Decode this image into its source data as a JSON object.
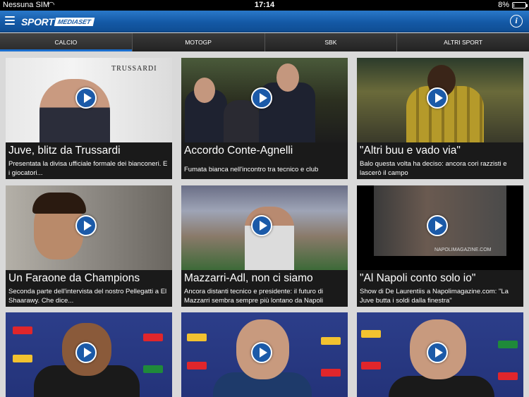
{
  "status_bar": {
    "carrier": "Nessuna SIM",
    "time": "17:14",
    "battery": "8%",
    "battery_level": 0.08
  },
  "navbar": {
    "logo_sport": "SPORT",
    "logo_mediaset": "MEDIASET",
    "info_glyph": "i"
  },
  "tabs": [
    {
      "label": "CALCIO",
      "active": true
    },
    {
      "label": "MOTOGP",
      "active": false
    },
    {
      "label": "SBK",
      "active": false
    },
    {
      "label": "ALTRI SPORT",
      "active": false
    }
  ],
  "accent_color": "#1b6fcf",
  "videos": [
    {
      "title": "Juve, blitz da Trussardi",
      "desc": "Presentata la divisa ufficiale formale dei bianconeri. E i giocatori...",
      "thumb_text": "TRUSSARDI"
    },
    {
      "title": "Accordo Conte-Agnelli",
      "desc": "Fumata bianca nell'incontro tra tecnico e club"
    },
    {
      "title": "\"Altri buu e vado via\"",
      "desc": "Balo questa volta ha deciso: ancora cori razzisti e lascerò il campo"
    },
    {
      "title": "Un Faraone da Champions",
      "desc": "Seconda parte dell'intervista del nostro Pellegatti a El Shaarawy. Che dice..."
    },
    {
      "title": "Mazzarri-Adl, non ci siamo",
      "desc": "Ancora distanti tecnico e presidente: il futuro di Mazzarri sembra sempre più lontano da Napoli"
    },
    {
      "title": "\"Al Napoli conto solo io\"",
      "desc": "Show di De Laurentiis a Napolimagazine.com: \"La Juve butta i soldi dalla finestra\"",
      "thumb_text": "NAPOLIMAGAZINE.COM"
    },
    {
      "title": "",
      "desc": ""
    },
    {
      "title": "",
      "desc": ""
    },
    {
      "title": "",
      "desc": ""
    }
  ]
}
